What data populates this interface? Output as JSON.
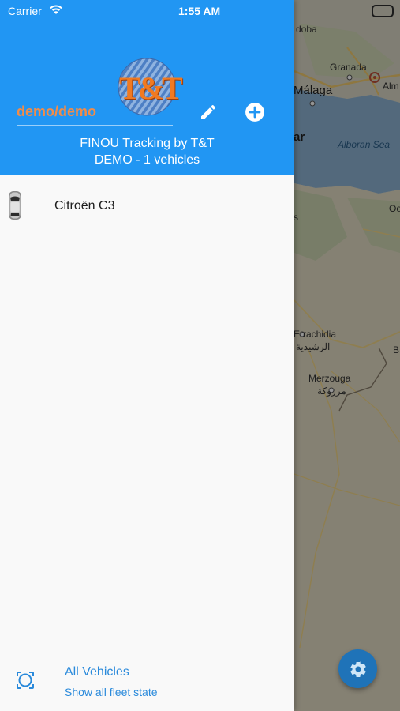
{
  "status_bar": {
    "carrier": "Carrier",
    "time": "1:55 AM"
  },
  "header": {
    "logo_text": "T&T",
    "account": "demo/demo",
    "title_line1": "FINOU Tracking by T&T",
    "title_line2": "DEMO - 1 vehicles"
  },
  "vehicles": [
    {
      "name": "Citroën C3"
    }
  ],
  "footer": {
    "title": "All Vehicles",
    "subtitle": "Show all fleet state"
  },
  "map": {
    "labels": {
      "cordoba": "doba",
      "granada": "Granada",
      "almeria": "Alm",
      "malaga": "Málaga",
      "ar": "ar",
      "alboran": "Alboran Sea",
      "s": "s",
      "oe": "Oe",
      "errachidia": "Errachidia",
      "errachidia_ar": "الرشيدية",
      "merzouga": "Merzouga",
      "merzouga_ar": "مرزوكة",
      "b": "B"
    }
  },
  "colors": {
    "header_bg": "#2196f3",
    "account_text": "#f28c48",
    "link": "#2a8adb",
    "fab": "#1f73b8"
  }
}
